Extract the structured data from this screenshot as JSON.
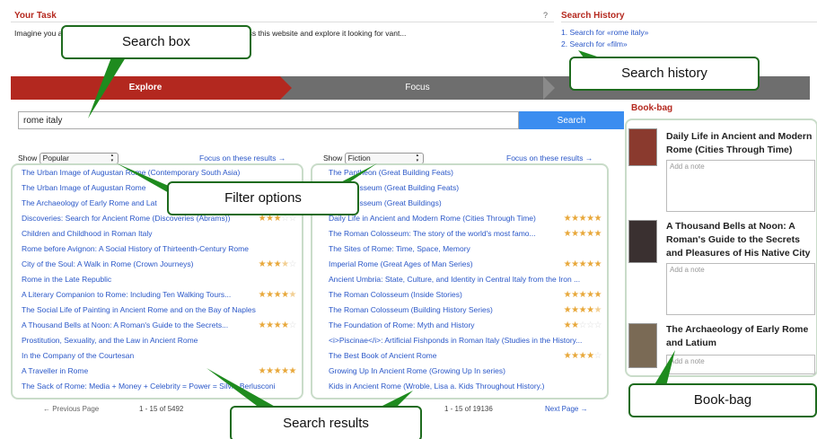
{
  "task": {
    "heading": "Your Task",
    "text": "Imagine you a                                              the airport or your office. While waiting, you come across this website and explore it looking for                                                        vant...",
    "help": "?"
  },
  "search_history": {
    "heading": "Search History",
    "items": [
      "1.  Search for «rome italy»",
      "2.  Search for «film»"
    ]
  },
  "steps": {
    "explore": "Explore",
    "focus": "Focus"
  },
  "search": {
    "value": "rome italy",
    "button": "Search"
  },
  "left_panel": {
    "show_label": "Show",
    "filter": "Popular",
    "focus_link": "Focus on these results →",
    "results": [
      {
        "title": "The Urban Image of Augustan Rome (Contemporary South Asia)",
        "stars": 0
      },
      {
        "title": "The Urban Image of Augustan Rome",
        "stars": 0
      },
      {
        "title": "The Archaeology of Early Rome and Lat",
        "stars": 0
      },
      {
        "title": "Discoveries: Search for Ancient Rome (Discoveries (Abrams))",
        "stars": 3
      },
      {
        "title": "Children and Childhood in Roman Italy",
        "stars": 0
      },
      {
        "title": "Rome before Avignon: A Social History of Thirteenth-Century Rome",
        "stars": 0
      },
      {
        "title": "City of the Soul: A Walk in Rome (Crown Journeys)",
        "stars": 3.5
      },
      {
        "title": "Rome in the Late Republic",
        "stars": 0
      },
      {
        "title": "A Literary Companion to Rome: Including Ten Walking Tours...",
        "stars": 4.5
      },
      {
        "title": "The Social Life of Painting in Ancient Rome and on the Bay of Naples",
        "stars": 0
      },
      {
        "title": "A Thousand Bells at Noon: A Roman's Guide to the Secrets...",
        "stars": 4
      },
      {
        "title": "Prostitution, Sexuality, and the Law in Ancient Rome",
        "stars": 0
      },
      {
        "title": "In the Company of the Courtesan",
        "stars": 0
      },
      {
        "title": "A Traveller in Rome",
        "stars": 5
      },
      {
        "title": "The Sack of Rome: Media + Money + Celebrity = Power = Silvio Berlusconi",
        "stars": 0
      }
    ],
    "prev": "← Previous Page",
    "count": "1 - 15 of 5492"
  },
  "right_panel": {
    "show_label": "Show",
    "filter": "Fiction",
    "focus_link": "Focus on these results →",
    "results": [
      {
        "title": "The Pantheon (Great Building Feats)",
        "stars": 0
      },
      {
        "title": "The Colosseum (Great Building Feats)",
        "stars": 0
      },
      {
        "title": "The Colosseum (Great Buildings)",
        "stars": 0
      },
      {
        "title": "Daily Life in Ancient and Modern Rome (Cities Through Time)",
        "stars": 5
      },
      {
        "title": "The Roman Colosseum: The story of the world's most famo...",
        "stars": 5
      },
      {
        "title": "The Sites of Rome: Time, Space, Memory",
        "stars": 0
      },
      {
        "title": "Imperial Rome (Great Ages of Man Series)",
        "stars": 5
      },
      {
        "title": "Ancient Umbria: State, Culture, and Identity in Central Italy from the Iron ...",
        "stars": 0
      },
      {
        "title": "The Roman Colosseum (Inside Stories)",
        "stars": 5
      },
      {
        "title": "The Roman Colosseum (Building History Series)",
        "stars": 4.5
      },
      {
        "title": "The Foundation of Rome: Myth and History",
        "stars": 2
      },
      {
        "title": "<i>Piscinae</i>: Artificial Fishponds in Roman Italy (Studies in the History...",
        "stars": 0
      },
      {
        "title": "The Best Book of Ancient Rome",
        "stars": 4
      },
      {
        "title": "Growing Up In Ancient Rome (Growing Up In series)",
        "stars": 0
      },
      {
        "title": "Kids in Ancient Rome (Wroble, Lisa a. Kids Throughout History.)",
        "stars": 0
      }
    ],
    "count": "1 - 15 of 19136",
    "next": "Next Page →"
  },
  "bookbag": {
    "heading": "Book-bag",
    "items": [
      {
        "title": "Daily Life in Ancient and Modern Rome (Cities Through Time)",
        "note_placeholder": "Add a note",
        "cover_color": "#8a3a2e"
      },
      {
        "title": "A Thousand Bells at Noon: A Roman's Guide to the Secrets and Pleasures of His Native City",
        "note_placeholder": "Add a note",
        "cover_color": "#3a3030"
      },
      {
        "title": "The Archaeology of Early Rome and Latium",
        "note_placeholder": "Add a note",
        "cover_color": "#7a6a55"
      }
    ]
  },
  "callouts": {
    "search_box": "Search box",
    "search_history": "Search history",
    "filter_options": "Filter options",
    "search_results": "Search results",
    "book_bag": "Book-bag"
  },
  "colors": {
    "accent": "#b3281f",
    "link": "#2a57c8",
    "button": "#3b8df0",
    "callout_border": "#1e6b1e",
    "panel_border": "#c9dcc9",
    "star": "#e8a83b"
  }
}
